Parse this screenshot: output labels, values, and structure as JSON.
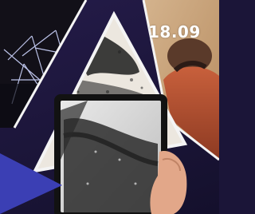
{
  "poster": {
    "date_text": "18.09"
  },
  "colors": {
    "background": "#1b1538",
    "accent_triangle": "#3b3fb4",
    "frame_white": "#f4f4f4",
    "laser_lines": "#cfd6ff"
  },
  "icons": {
    "accent": "triangle"
  }
}
